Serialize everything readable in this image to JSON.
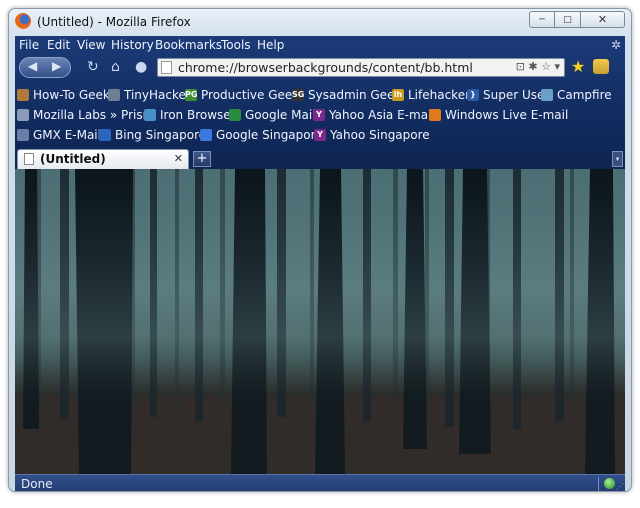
{
  "window": {
    "title": "(Untitled) - Mozilla Firefox",
    "min_glyph": "─",
    "max_glyph": "□",
    "close_glyph": "✕"
  },
  "menu": [
    {
      "label": "File"
    },
    {
      "label": "Edit"
    },
    {
      "label": "View"
    },
    {
      "label": "History"
    },
    {
      "label": "Bookmarks"
    },
    {
      "label": "Tools"
    },
    {
      "label": "Help"
    }
  ],
  "nav": {
    "back_glyph": "◀",
    "forward_glyph": "▶",
    "reload_glyph": "↻",
    "home_glyph": "⌂",
    "stop_glyph": "●",
    "url": "chrome://browserbackgrounds/content/bb.html",
    "url_icons": "⊡ ✱ ☆ ▾",
    "star_glyph": "★"
  },
  "bookmarks_row1": [
    {
      "label": "How-To Geek",
      "icon": "how-to-geek-icon",
      "color": "#b07a3a",
      "glyph": ""
    },
    {
      "label": "TinyHacker",
      "icon": "tinyhacker-icon",
      "color": "#6d7f95",
      "glyph": ""
    },
    {
      "label": "Productive Geek",
      "icon": "productive-geek-icon",
      "color": "#3e8f2d",
      "glyph": "PG"
    },
    {
      "label": "Sysadmin Geek",
      "icon": "sysadmin-geek-icon",
      "color": "#333333",
      "glyph": "SG"
    },
    {
      "label": "Lifehacker",
      "icon": "lifehacker-icon",
      "color": "#c99a1c",
      "glyph": "lh"
    },
    {
      "label": "Super User",
      "icon": "super-user-icon",
      "color": "#2c5aa8",
      "glyph": "}"
    },
    {
      "label": "Campfire",
      "icon": "campfire-icon",
      "color": "#6aa0c8",
      "glyph": ""
    }
  ],
  "bookmarks_row2": [
    {
      "label": "Mozilla Labs » Prism",
      "icon": "prism-icon",
      "color": "#8a9bb8",
      "glyph": ""
    },
    {
      "label": "Iron Browser",
      "icon": "iron-browser-icon",
      "color": "#4a8fc9",
      "glyph": ""
    },
    {
      "label": "Google Mail",
      "icon": "google-mail-icon",
      "color": "#2a8a3c",
      "glyph": ""
    },
    {
      "label": "Yahoo Asia E-mail",
      "icon": "yahoo-icon",
      "color": "#7b2a8c",
      "glyph": "Y"
    },
    {
      "label": "Windows Live E-mail",
      "icon": "windows-live-icon",
      "color": "#e07a1a",
      "glyph": ""
    }
  ],
  "bookmarks_row3": [
    {
      "label": "GMX E-Mail",
      "icon": "gmx-icon",
      "color": "#6a7ea8",
      "glyph": ""
    },
    {
      "label": "Bing Singapore",
      "icon": "bing-icon",
      "color": "#2a66c0",
      "glyph": ""
    },
    {
      "label": "Google Singapore",
      "icon": "google-icon",
      "color": "#3b78e0",
      "glyph": ""
    },
    {
      "label": "Yahoo Singapore",
      "icon": "yahoo-icon",
      "color": "#7b2a8c",
      "glyph": "Y"
    }
  ],
  "tabs": [
    {
      "label": "(Untitled)",
      "close_glyph": "✕"
    }
  ],
  "newtab_glyph": "+",
  "tablist_glyph": "▾",
  "status": {
    "text": "Done"
  }
}
